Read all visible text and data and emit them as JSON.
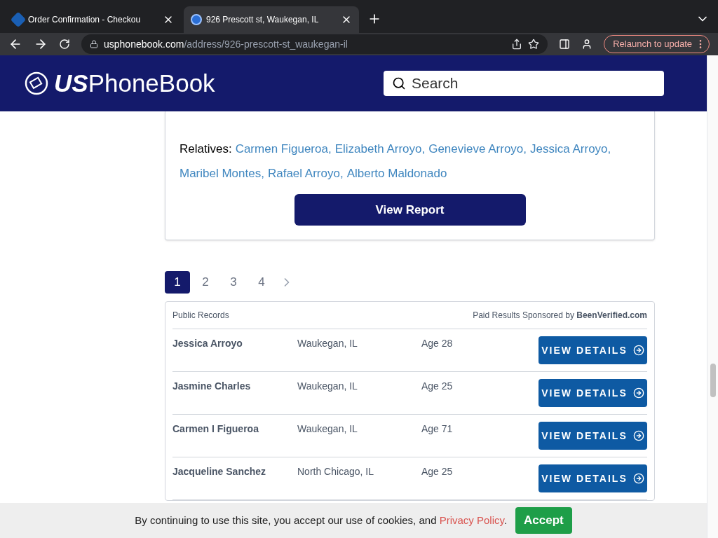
{
  "browser": {
    "tabs": [
      {
        "title": "Order Confirmation - Checkou",
        "selected": false
      },
      {
        "title": "926 Prescott st, Waukegan, IL",
        "selected": true
      }
    ],
    "url_host": "usphonebook.com",
    "url_path": "/address/926-prescott-st_waukegan-il",
    "relaunch": "Relaunch to update"
  },
  "header": {
    "logo_bold": "US",
    "logo_rest": "PhoneBook",
    "search": {
      "placeholder": "Search"
    }
  },
  "card": {
    "relatives_label": "Relatives:",
    "relatives": [
      "Carmen Figueroa,",
      "Elizabeth Arroyo,",
      "Genevieve Arroyo,",
      "Jessica Arroyo,",
      "Maribel Montes,",
      "Rafael Arroyo,",
      "Alberto Maldonado"
    ],
    "button": "View Report"
  },
  "pagination": [
    {
      "label": "1",
      "selected": true
    },
    {
      "label": "2",
      "selected": false
    },
    {
      "label": "3",
      "selected": false
    },
    {
      "label": "4",
      "selected": false
    }
  ],
  "records": {
    "title": "Public Records",
    "sponsor": "Paid Results Sponsored by **BeenVerified.com**",
    "rows": [
      {
        "name": "Jessica Arroyo",
        "city": "Waukegan, IL",
        "age": "Age 28",
        "button": "VIEW DETAILS"
      },
      {
        "name": "Jasmine Charles",
        "city": "Waukegan, IL",
        "age": "Age 25",
        "button": "VIEW DETAILS"
      },
      {
        "name": "Carmen I Figueroa",
        "city": "Waukegan, IL",
        "age": "Age 71",
        "button": "VIEW DETAILS"
      },
      {
        "name": "Jacqueline Sanchez",
        "city": "North Chicago, IL",
        "age": "Age 25",
        "button": "VIEW DETAILS"
      }
    ]
  },
  "cookie": {
    "text": "By continuing to use this site, you accept our use of cookies, and",
    "link": "Privacy Policy",
    "end": ".",
    "button": "Accept"
  }
}
